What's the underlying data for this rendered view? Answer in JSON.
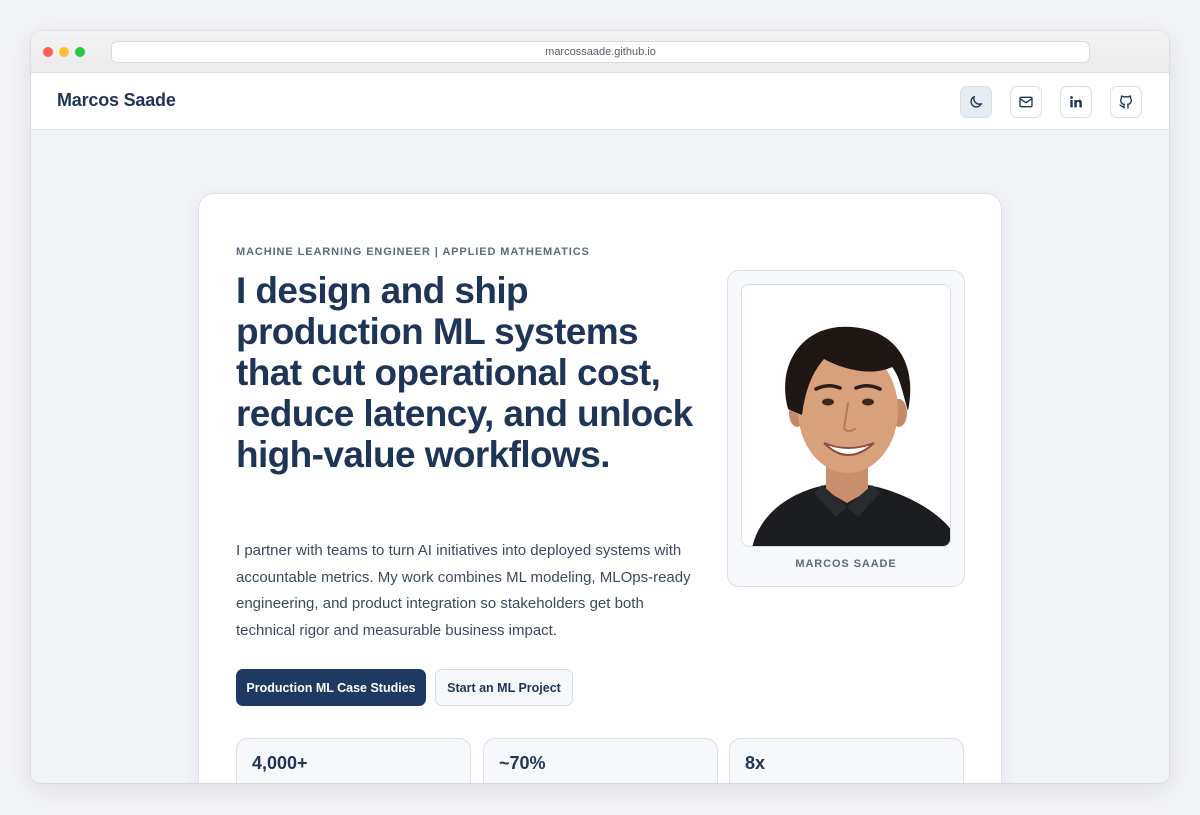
{
  "browser": {
    "url": "marcossaade.github.io"
  },
  "nav": {
    "brand": "Marcos Saade",
    "icons": [
      "moon-icon",
      "mail-icon",
      "linkedin-icon",
      "github-icon"
    ]
  },
  "hero": {
    "eyebrow": "MACHINE LEARNING ENGINEER | APPLIED MATHEMATICS",
    "headline": "I design and ship production ML systems that cut operational cost, reduce latency, and unlock high-value workflows.",
    "lead": "I partner with teams to turn AI initiatives into deployed systems with accountable metrics. My work combines ML modeling, MLOps-ready engineering, and product integration so stakeholders get both technical rigor and measurable business impact.",
    "primary_cta": "Production ML Case Studies",
    "secondary_cta": "Start an ML Project",
    "photo_caption": "MARCOS SAADE"
  },
  "stats": [
    {
      "value": "4,000+"
    },
    {
      "value": "~70%"
    },
    {
      "value": "8x"
    }
  ],
  "colors": {
    "navy": "#1e3557",
    "primary_button": "#1e3a62",
    "muted_text": "#5d6b80",
    "page_bg": "#f2f4f8"
  }
}
